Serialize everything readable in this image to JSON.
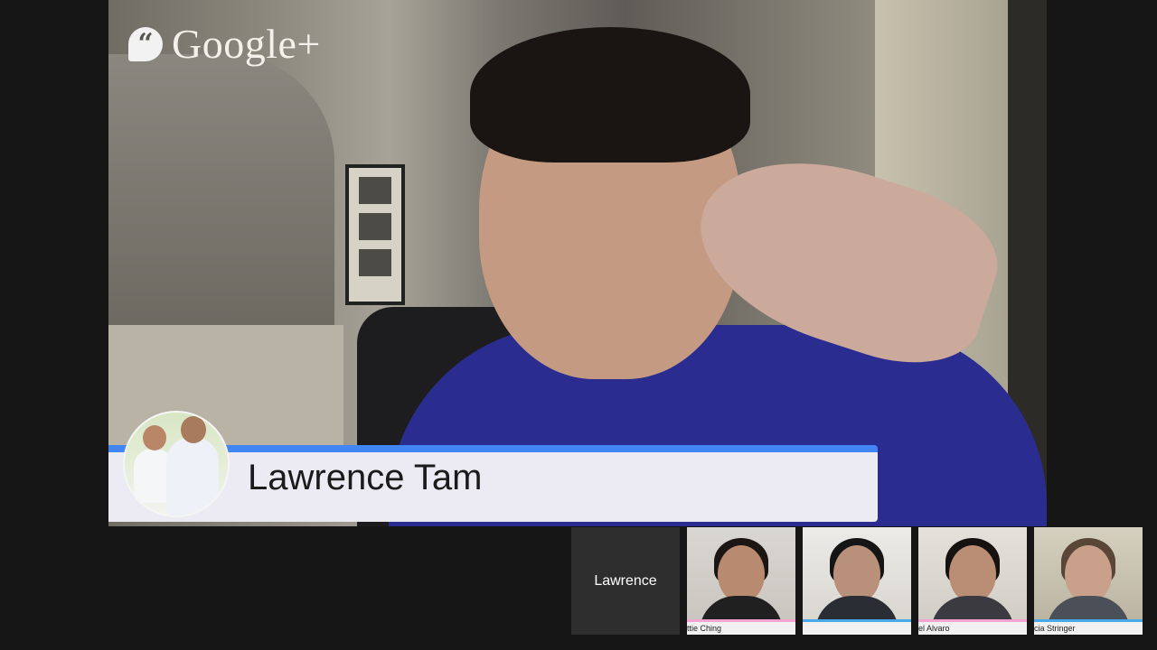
{
  "app": {
    "logo_text": "Google+",
    "logo_icon": "hangouts-quote-icon"
  },
  "speaker": {
    "name": "Lawrence Tam",
    "accent_color": "#4285f4"
  },
  "participants": [
    {
      "label": "Lawrence",
      "is_self": true
    },
    {
      "label": "Ettie Ching",
      "visible_label": "ttie Ching"
    },
    {
      "label": "",
      "visible_label": ""
    },
    {
      "label": "Abel Alvaro",
      "visible_label": "el Alvaro"
    },
    {
      "label": "Marcia Stringer",
      "visible_label": "cia Stringer"
    }
  ]
}
